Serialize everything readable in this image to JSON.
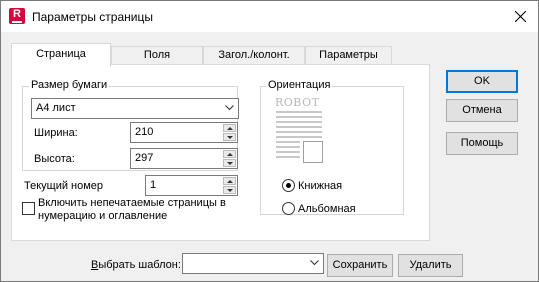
{
  "window": {
    "title": "Параметры страницы",
    "app_icon_letter": "R"
  },
  "tabs": [
    {
      "label": "Страница",
      "active": true
    },
    {
      "label": "Поля",
      "active": false
    },
    {
      "label": "Загол./колонт.",
      "active": false
    },
    {
      "label": "Параметры",
      "active": false
    }
  ],
  "paper": {
    "group_title": "Размер бумаги",
    "format": "А4 лист",
    "width_label": "Ширина:",
    "width_value": "210",
    "height_label": "Высота:",
    "height_value": "297"
  },
  "page_number": {
    "label": "Текущий номер",
    "value": "1"
  },
  "include_checkbox": {
    "line1": "Включить непечатаемые страницы в",
    "line2": "нумерацию и оглавление",
    "checked": false
  },
  "orientation": {
    "group_title": "Ориентация",
    "preview_text": "ROBOT",
    "portrait_label": "Книжная",
    "landscape_label": "Альбомная",
    "selected": "portrait"
  },
  "buttons": {
    "ok": "OK",
    "cancel": "Отмена",
    "help": "Помощь"
  },
  "footer": {
    "template_label_first": "В",
    "template_label_rest": "ыбрать шаблон:",
    "template_value": "",
    "save_label": "Сохранить",
    "delete_label": "Удалить"
  },
  "colors": {
    "accent": "#0078d7",
    "app_icon": "#d9003b"
  }
}
